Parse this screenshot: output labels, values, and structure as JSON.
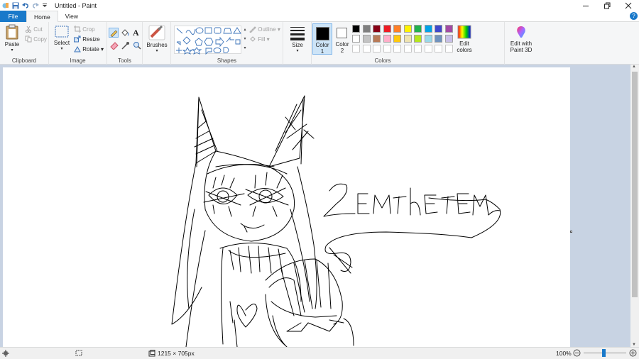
{
  "window": {
    "title": "Untitled - Paint"
  },
  "tabs": {
    "file": "File",
    "home": "Home",
    "view": "View"
  },
  "clipboard": {
    "paste": "Paste",
    "cut": "Cut",
    "copy": "Copy",
    "label": "Clipboard"
  },
  "image": {
    "select": "Select",
    "crop": "Crop",
    "resize": "Resize",
    "rotate": "Rotate",
    "label": "Image"
  },
  "tools": {
    "label": "Tools"
  },
  "brushes": {
    "label": "Brushes"
  },
  "shapes": {
    "outline": "Outline",
    "fill": "Fill",
    "label": "Shapes"
  },
  "size": {
    "label": "Size"
  },
  "color1": {
    "line1": "Color",
    "line2": "1",
    "value": "#000000"
  },
  "color2": {
    "line1": "Color",
    "line2": "2",
    "value": "#ffffff"
  },
  "colors": {
    "label": "Colors",
    "edit": "Edit",
    "edit2": "colors",
    "palette": [
      "#000000",
      "#7f7f7f",
      "#880015",
      "#ed1c24",
      "#ff7f27",
      "#fff200",
      "#22b14c",
      "#00a2e8",
      "#3f48cc",
      "#a349a4",
      "#ffffff",
      "#c3c3c3",
      "#b97a57",
      "#ffaec9",
      "#ffc90e",
      "#efe4b0",
      "#b5e61d",
      "#99d9ea",
      "#7092be",
      "#c8bfe7"
    ]
  },
  "paint3d": {
    "line1": "Edit with",
    "line2": "Paint 3D"
  },
  "canvas": {
    "drawn_text": "ZEMTHETEM"
  },
  "status": {
    "dimensions": "1215 × 705px",
    "zoom": "100%"
  }
}
